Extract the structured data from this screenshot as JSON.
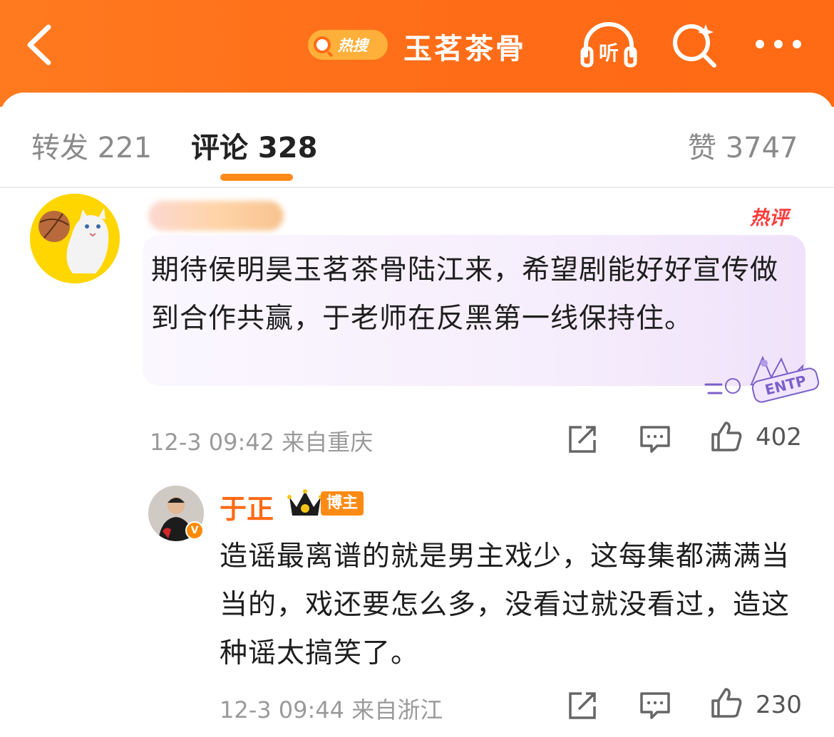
{
  "header": {
    "hot_label": "热搜",
    "topic": "玉茗茶骨",
    "listen_label": "听"
  },
  "tabs": [
    {
      "label": "转发 221"
    },
    {
      "label": "评论 328"
    },
    {
      "label": "赞 3747"
    }
  ],
  "comment": {
    "hot_tag": "热评",
    "text": "期待侯明昊玉茗茶骨陆江来，希望剧能好好宣传做到合作共赢，于老师在反黑第一线保持住。",
    "meta": "12-3 09:42 来自重庆",
    "likes": "402",
    "badge_label": "ENTP"
  },
  "reply": {
    "author": "于正",
    "badge": "博主",
    "text": "造谣最离谱的就是男主戏少，这每集都满满当当的，戏还要怎么多，没看过就没看过，造这种谣太搞笑了。",
    "meta": "12-3 09:44 来自浙江",
    "likes": "230",
    "verified_mark": "V"
  },
  "colors": {
    "header_bg": "#ff6b17",
    "accent": "#ff8a1c",
    "author_name": "#ff6a14",
    "hot_tag": "#ff3b3b"
  }
}
